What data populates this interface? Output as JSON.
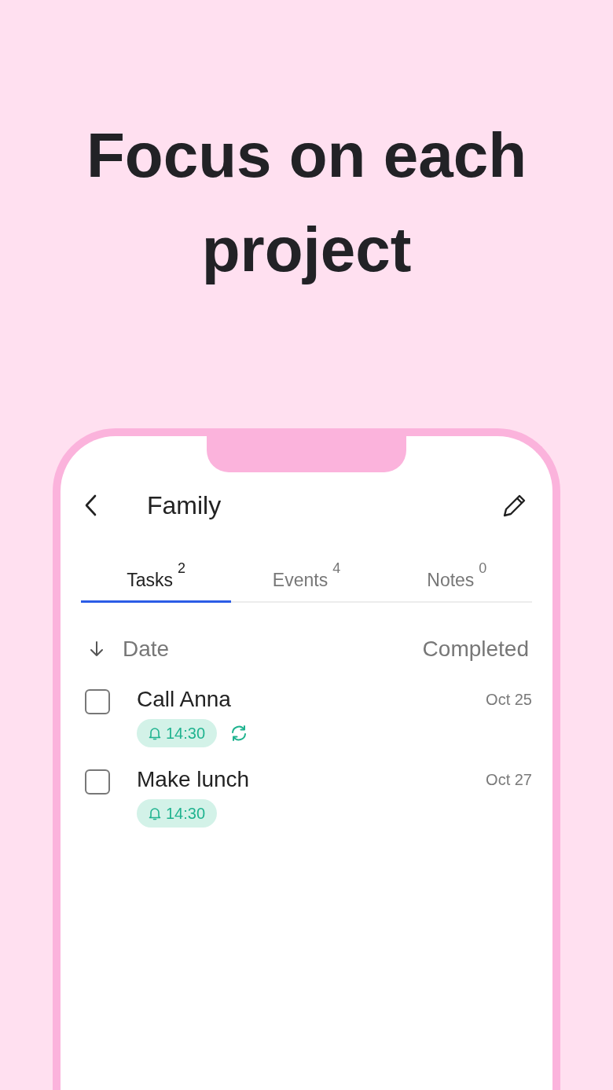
{
  "headline": "Focus on each project",
  "header": {
    "title": "Family"
  },
  "tabs": [
    {
      "label": "Tasks",
      "count": "2",
      "selected": true
    },
    {
      "label": "Events",
      "count": "4",
      "selected": false
    },
    {
      "label": "Notes",
      "count": "0",
      "selected": false
    }
  ],
  "sort": {
    "label": "Date",
    "filter": "Completed"
  },
  "tasks": [
    {
      "title": "Call Anna",
      "date": "Oct 25",
      "checked": false,
      "reminder": "14:30",
      "repeat": true
    },
    {
      "title": "Make lunch",
      "date": "Oct 27",
      "checked": false,
      "reminder": "14:30",
      "repeat": false
    }
  ]
}
